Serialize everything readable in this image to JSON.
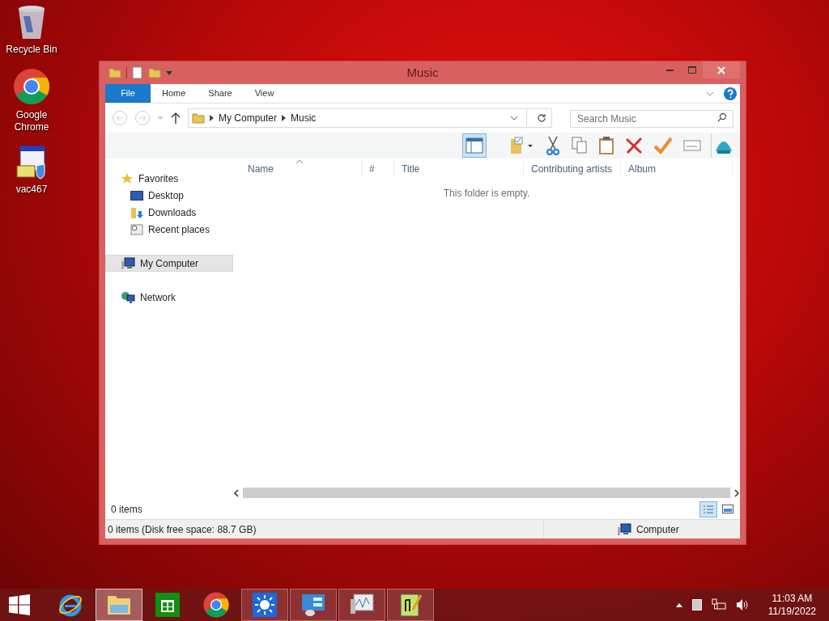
{
  "desktop_icons": [
    {
      "kind": "recycle",
      "label": "Recycle Bin"
    },
    {
      "kind": "chrome",
      "label": "Google Chrome"
    },
    {
      "kind": "installer",
      "label": "vac467"
    }
  ],
  "window": {
    "title": "Music",
    "ribbon_tabs": [
      {
        "label": "File",
        "selected": true
      },
      {
        "label": "Home",
        "selected": false
      },
      {
        "label": "Share",
        "selected": false
      },
      {
        "label": "View",
        "selected": false
      }
    ],
    "path": [
      "My Computer",
      "Music"
    ],
    "search": {
      "placeholder": "Search Music"
    },
    "toolbar": [
      {
        "kind": "preview-pane",
        "selected": true
      },
      {
        "kind": "folder-check",
        "selected": false
      },
      {
        "kind": "cut",
        "selected": false
      },
      {
        "kind": "copy",
        "selected": false
      },
      {
        "kind": "paste",
        "selected": false
      },
      {
        "kind": "delete",
        "selected": false
      },
      {
        "kind": "check",
        "selected": false
      },
      {
        "kind": "rename",
        "selected": false
      },
      {
        "kind": "shell",
        "selected": false
      }
    ],
    "nav": [
      {
        "kind": "star",
        "label": "Favorites",
        "selected": false,
        "children": [
          {
            "kind": "desktop",
            "label": "Desktop",
            "selected": false
          },
          {
            "kind": "downloads",
            "label": "Downloads",
            "selected": false
          },
          {
            "kind": "recent",
            "label": "Recent places",
            "selected": false
          }
        ]
      },
      {
        "kind": "computer",
        "label": "My Computer",
        "selected": true
      },
      {
        "kind": "network",
        "label": "Network",
        "selected": false
      }
    ],
    "columns": [
      "Name",
      "#",
      "Title",
      "Contributing artists",
      "Album"
    ],
    "empty_message": "This folder is empty.",
    "item_count": "0 items",
    "views": [
      {
        "kind": "details",
        "selected": true
      },
      {
        "kind": "preview",
        "selected": false
      }
    ],
    "status_text": "0 items (Disk free space: 88.7 GB)",
    "status_location": "Computer"
  },
  "taskbar": {
    "apps": [
      {
        "kind": "ie",
        "selected": false,
        "running": false
      },
      {
        "kind": "explorer",
        "selected": true,
        "running": true
      },
      {
        "kind": "store",
        "selected": false,
        "running": false
      },
      {
        "kind": "chrome",
        "selected": false,
        "running": false
      },
      {
        "kind": "sun",
        "selected": false,
        "running": true
      },
      {
        "kind": "control",
        "selected": false,
        "running": true
      },
      {
        "kind": "monitor",
        "selected": false,
        "running": true
      },
      {
        "kind": "notepad",
        "selected": false,
        "running": true
      }
    ],
    "time": "11:03 AM",
    "date": "11/19/2022"
  }
}
